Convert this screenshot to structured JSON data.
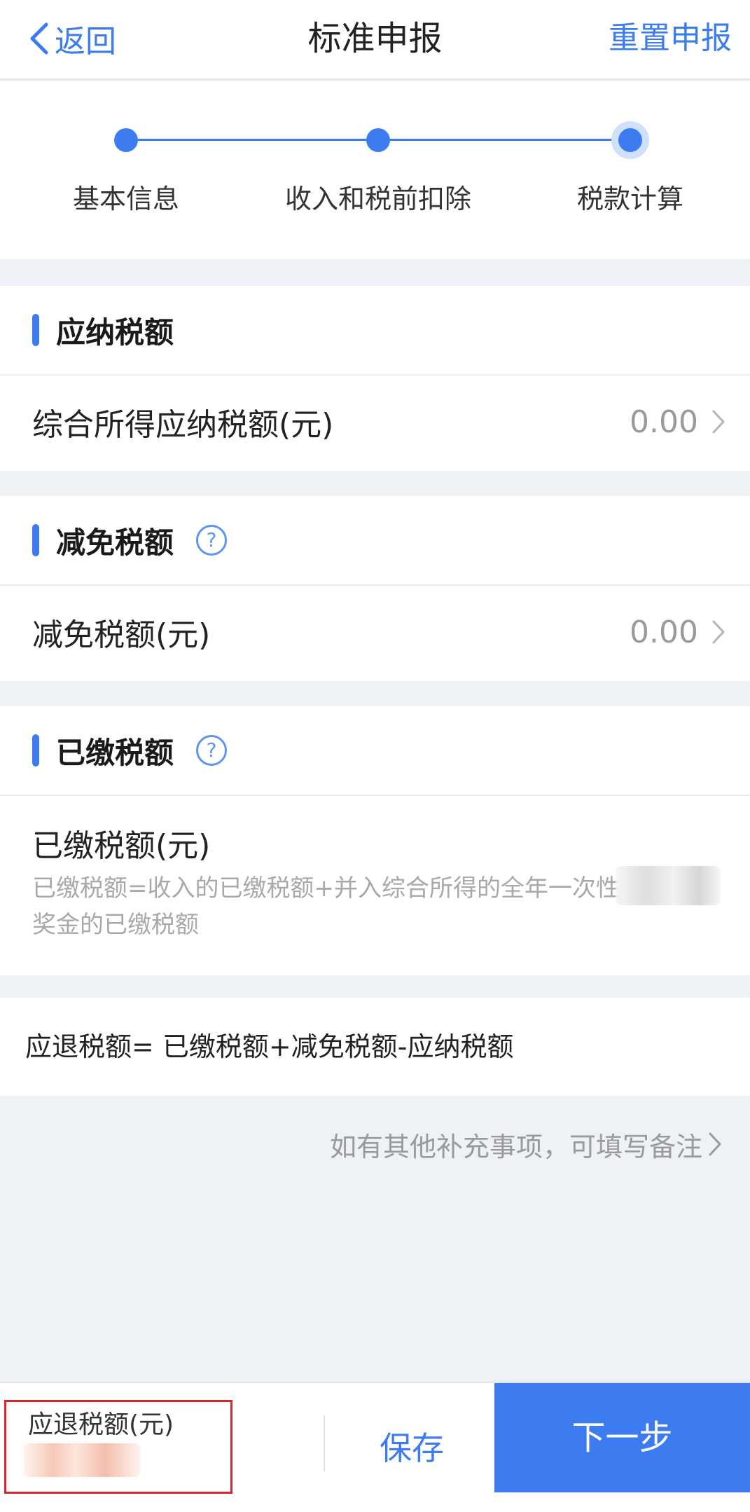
{
  "header": {
    "back_label": "返回",
    "title": "标准申报",
    "reset_label": "重置申报"
  },
  "steps": [
    {
      "label": "基本信息"
    },
    {
      "label": "收入和税前扣除"
    },
    {
      "label": "税款计算"
    }
  ],
  "current_step": 3,
  "sections": {
    "payable": {
      "title": "应纳税额",
      "row_label": "综合所得应纳税额(元)",
      "row_value": "0.00"
    },
    "reduction": {
      "title": "减免税额",
      "help_symbol": "?",
      "row_label": "减免税额(元)",
      "row_value": "0.00"
    },
    "paid": {
      "title": "已缴税额",
      "help_symbol": "?",
      "row_label": "已缴税额(元)",
      "row_desc": "已缴税额=收入的已缴税额+并入综合所得的全年一次性奖金的已缴税额"
    }
  },
  "formula": "应退税额= 已缴税额+减免税额-应纳税额",
  "remark_link": "如有其他补充事项，可填写备注",
  "bottom": {
    "refund_label": "应退税额(元)",
    "save_label": "保存",
    "next_label": "下一步"
  },
  "colors": {
    "accent": "#3d7cf0",
    "highlight_border": "#d9262b"
  },
  "icons": {
    "back": "chevron-left-icon",
    "row_arrow": "chevron-right-icon",
    "help": "question-circle-icon"
  }
}
